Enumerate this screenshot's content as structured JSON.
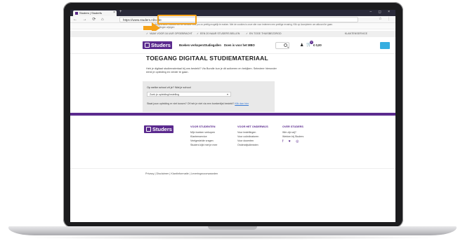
{
  "browser": {
    "tab_title": "Studers | Studerfs",
    "url": "https://www.studers.nl/code",
    "cookie_notice": "Wij gebruiken cookies om de website voor jou zo prettig mogelijk te maken. Met de cookies is onze site voor iedereen een prettige ervaring. Klik op Accepteren om akkoord te gaan. Instellingen wijzigen",
    "accent_color": "#f5a21a"
  },
  "usp_bar": {
    "items": [
      "VAAK VOOR 16 UUR OPGEBRACHT",
      "EEN 20 NAAR STUDERS BELLEN",
      "EN TOGE THUISBEZORGD"
    ],
    "right": "KLANTENSERVICE"
  },
  "header": {
    "logo": "Studers",
    "nav": [
      "Boeken verkopen",
      "Studiegallen",
      "Doen is voor het MBO"
    ],
    "cart_count": "0",
    "cart_price": "€ 0,00",
    "brand_color": "#5b2a8e"
  },
  "main": {
    "title": "TOEGANG DIGITAAL STUDIEMATERIAAL",
    "intro": "Heb je digitaal studiemateriaal bij ons besteld? Via Bundle kun je dit activeren en bekijken. Selecteer hieronder eerst je opleiding en verder te gaan.",
    "form_label": "Op welke school zit je? Wat je school",
    "select_value": "Zoek je opleiding/instelling",
    "note_text": "Staat jouw opleiding er niet tussen? Of heb je niet via een boekenlijst besteld?",
    "note_link": "Klik dan hier"
  },
  "footer": {
    "logo": "Studers",
    "columns": [
      {
        "heading": "VOOR STUDENTEN",
        "links": [
          "Mijn boeken verkopen",
          "Klantenservice",
          "Veelgestelde vragen",
          "Studers kijkt met je mee"
        ]
      },
      {
        "heading": "VOOR HET ONDERWIJS",
        "links": [
          "Voor instellingen",
          "Voor coördinatoren",
          "Voor docenten",
          "Onderwijsdiensten"
        ]
      },
      {
        "heading": "OVER STUDERS",
        "links": [
          "Wie zijn wij?",
          "Werken bij Studers"
        ]
      }
    ],
    "legal": "Privacy  |  Disclaimer  |  Klantinformatie  |  Leveringsvoorwaarden"
  }
}
